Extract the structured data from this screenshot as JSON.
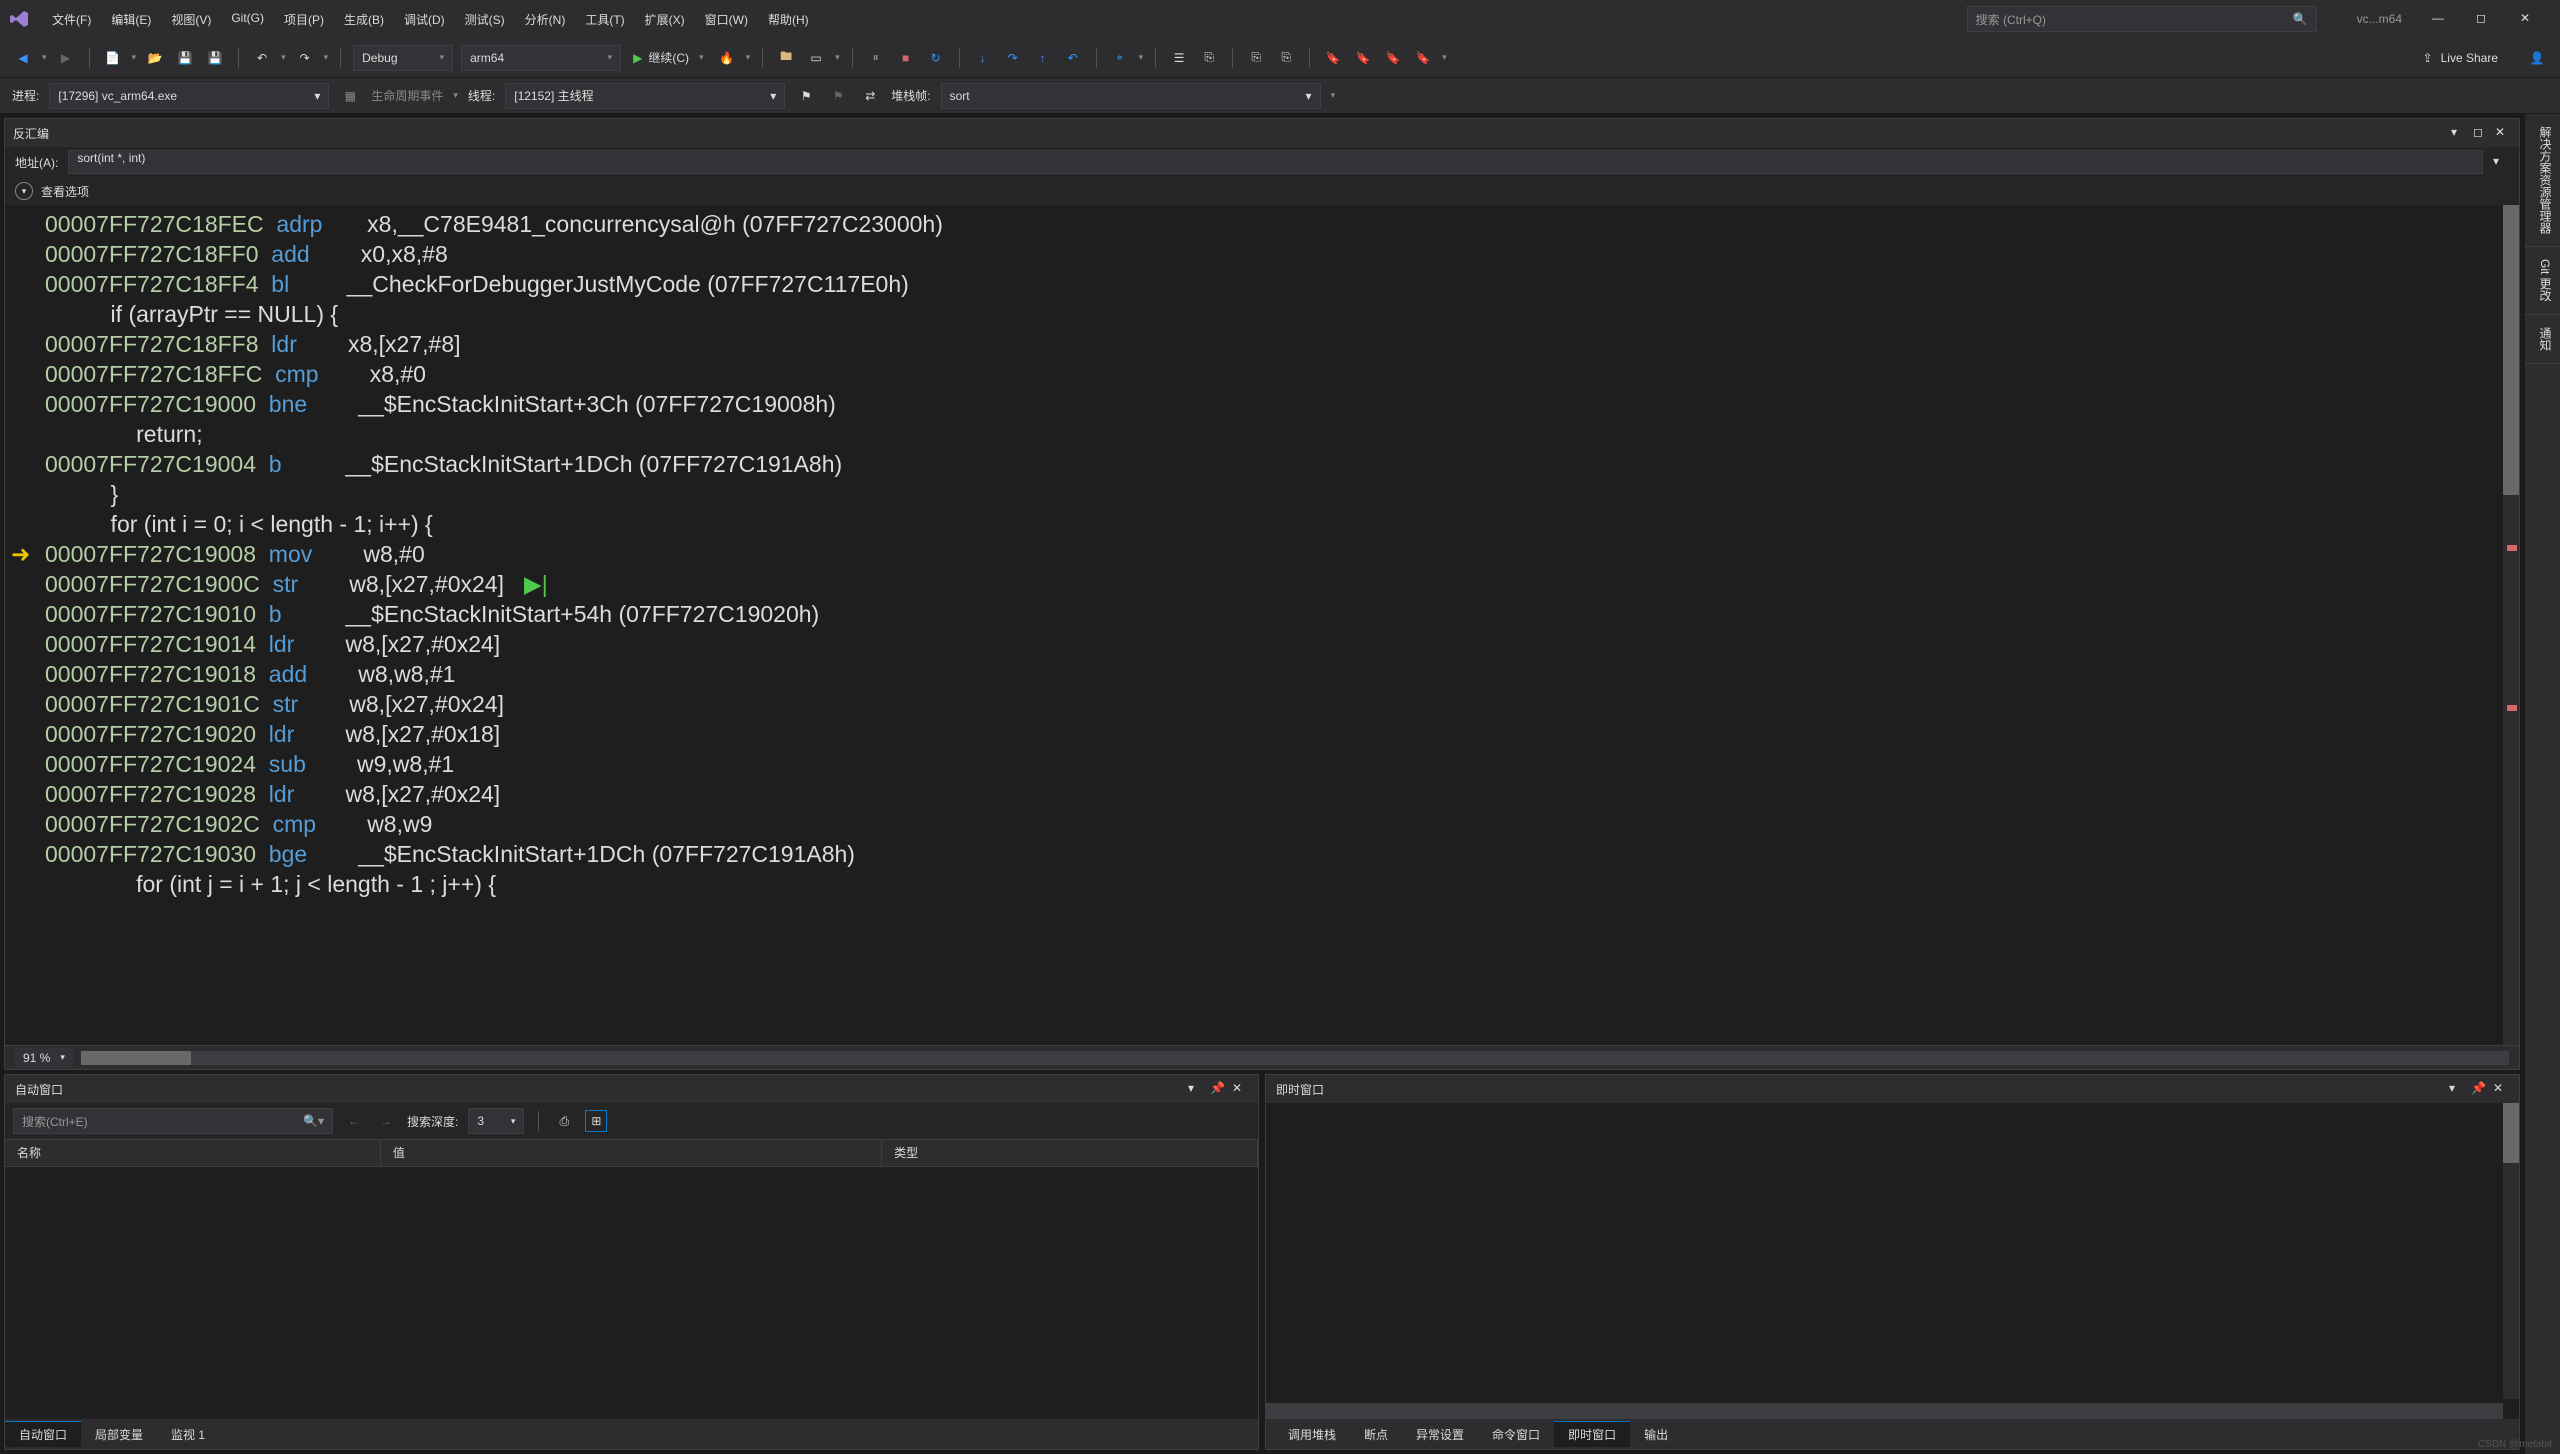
{
  "menu": [
    "文件(F)",
    "编辑(E)",
    "视图(V)",
    "Git(G)",
    "项目(P)",
    "生成(B)",
    "调试(D)",
    "测试(S)",
    "分析(N)",
    "工具(T)",
    "扩展(X)",
    "窗口(W)",
    "帮助(H)"
  ],
  "search_placeholder": "搜索 (Ctrl+Q)",
  "window_title": "vc...m64",
  "config": "Debug",
  "platform": "arm64",
  "continue_label": "继续(C)",
  "live_share": "Live Share",
  "process_label": "进程:",
  "process_value": "[17296] vc_arm64.exe",
  "lifecycle_label": "生命周期事件",
  "thread_label": "线程:",
  "thread_value": "[12152] 主线程",
  "stackframe_label": "堆栈帧:",
  "stackframe_value": "sort",
  "disasm_title": "反汇编",
  "addr_label": "地址(A):",
  "addr_value": "sort(int *, int)",
  "view_options": "查看选项",
  "zoom": "91 %",
  "code": [
    {
      "t": "asm",
      "a": "00007FF727C18FEC",
      "m": "adrp",
      "o": "x8,__C78E9481_concurrencysal@h (07FF727C23000h)"
    },
    {
      "t": "asm",
      "a": "00007FF727C18FF0",
      "m": "add",
      "o": "x0,x8,#8"
    },
    {
      "t": "asm",
      "a": "00007FF727C18FF4",
      "m": "bl",
      "o": "__CheckForDebuggerJustMyCode (07FF727C117E0h)"
    },
    {
      "t": "src",
      "s": "    if (arrayPtr == NULL) {"
    },
    {
      "t": "asm",
      "a": "00007FF727C18FF8",
      "m": "ldr",
      "o": "x8,[x27,#8]"
    },
    {
      "t": "asm",
      "a": "00007FF727C18FFC",
      "m": "cmp",
      "o": "x8,#0"
    },
    {
      "t": "asm",
      "a": "00007FF727C19000",
      "m": "bne",
      "o": "__$EncStackInitStart+3Ch (07FF727C19008h)"
    },
    {
      "t": "src",
      "s": "        return;"
    },
    {
      "t": "asm",
      "a": "00007FF727C19004",
      "m": "b",
      "o": "__$EncStackInitStart+1DCh (07FF727C191A8h)"
    },
    {
      "t": "src",
      "s": "    }"
    },
    {
      "t": "src",
      "s": "    for (int i = 0; i < length - 1; i++) {"
    },
    {
      "t": "asm",
      "a": "00007FF727C19008",
      "m": "mov",
      "o": "w8,#0",
      "cur": true
    },
    {
      "t": "asm",
      "a": "00007FF727C1900C",
      "m": "str",
      "o": "w8,[x27,#0x24]",
      "ptr": true
    },
    {
      "t": "asm",
      "a": "00007FF727C19010",
      "m": "b",
      "o": "__$EncStackInitStart+54h (07FF727C19020h)"
    },
    {
      "t": "asm",
      "a": "00007FF727C19014",
      "m": "ldr",
      "o": "w8,[x27,#0x24]"
    },
    {
      "t": "asm",
      "a": "00007FF727C19018",
      "m": "add",
      "o": "w8,w8,#1"
    },
    {
      "t": "asm",
      "a": "00007FF727C1901C",
      "m": "str",
      "o": "w8,[x27,#0x24]"
    },
    {
      "t": "asm",
      "a": "00007FF727C19020",
      "m": "ldr",
      "o": "w8,[x27,#0x18]"
    },
    {
      "t": "asm",
      "a": "00007FF727C19024",
      "m": "sub",
      "o": "w9,w8,#1"
    },
    {
      "t": "asm",
      "a": "00007FF727C19028",
      "m": "ldr",
      "o": "w8,[x27,#0x24]"
    },
    {
      "t": "asm",
      "a": "00007FF727C1902C",
      "m": "cmp",
      "o": "w8,w9"
    },
    {
      "t": "asm",
      "a": "00007FF727C19030",
      "m": "bge",
      "o": "__$EncStackInitStart+1DCh (07FF727C191A8h)"
    },
    {
      "t": "src",
      "s": "        for (int j = i + 1; j < length - 1 ; j++) {"
    }
  ],
  "autos_title": "自动窗口",
  "autos_search": "搜索(Ctrl+E)",
  "depth_label": "搜索深度:",
  "depth_value": "3",
  "grid_cols": [
    "名称",
    "值",
    "类型"
  ],
  "autos_tabs": [
    "自动窗口",
    "局部变量",
    "监视 1"
  ],
  "immediate_title": "即时窗口",
  "bottom_right_tabs": [
    "调用堆栈",
    "断点",
    "异常设置",
    "命令窗口",
    "即时窗口",
    "输出"
  ],
  "side_tabs": [
    "解决方案资源管理器",
    "Git 更改",
    "通知"
  ],
  "footer": "CSDN @metabit"
}
